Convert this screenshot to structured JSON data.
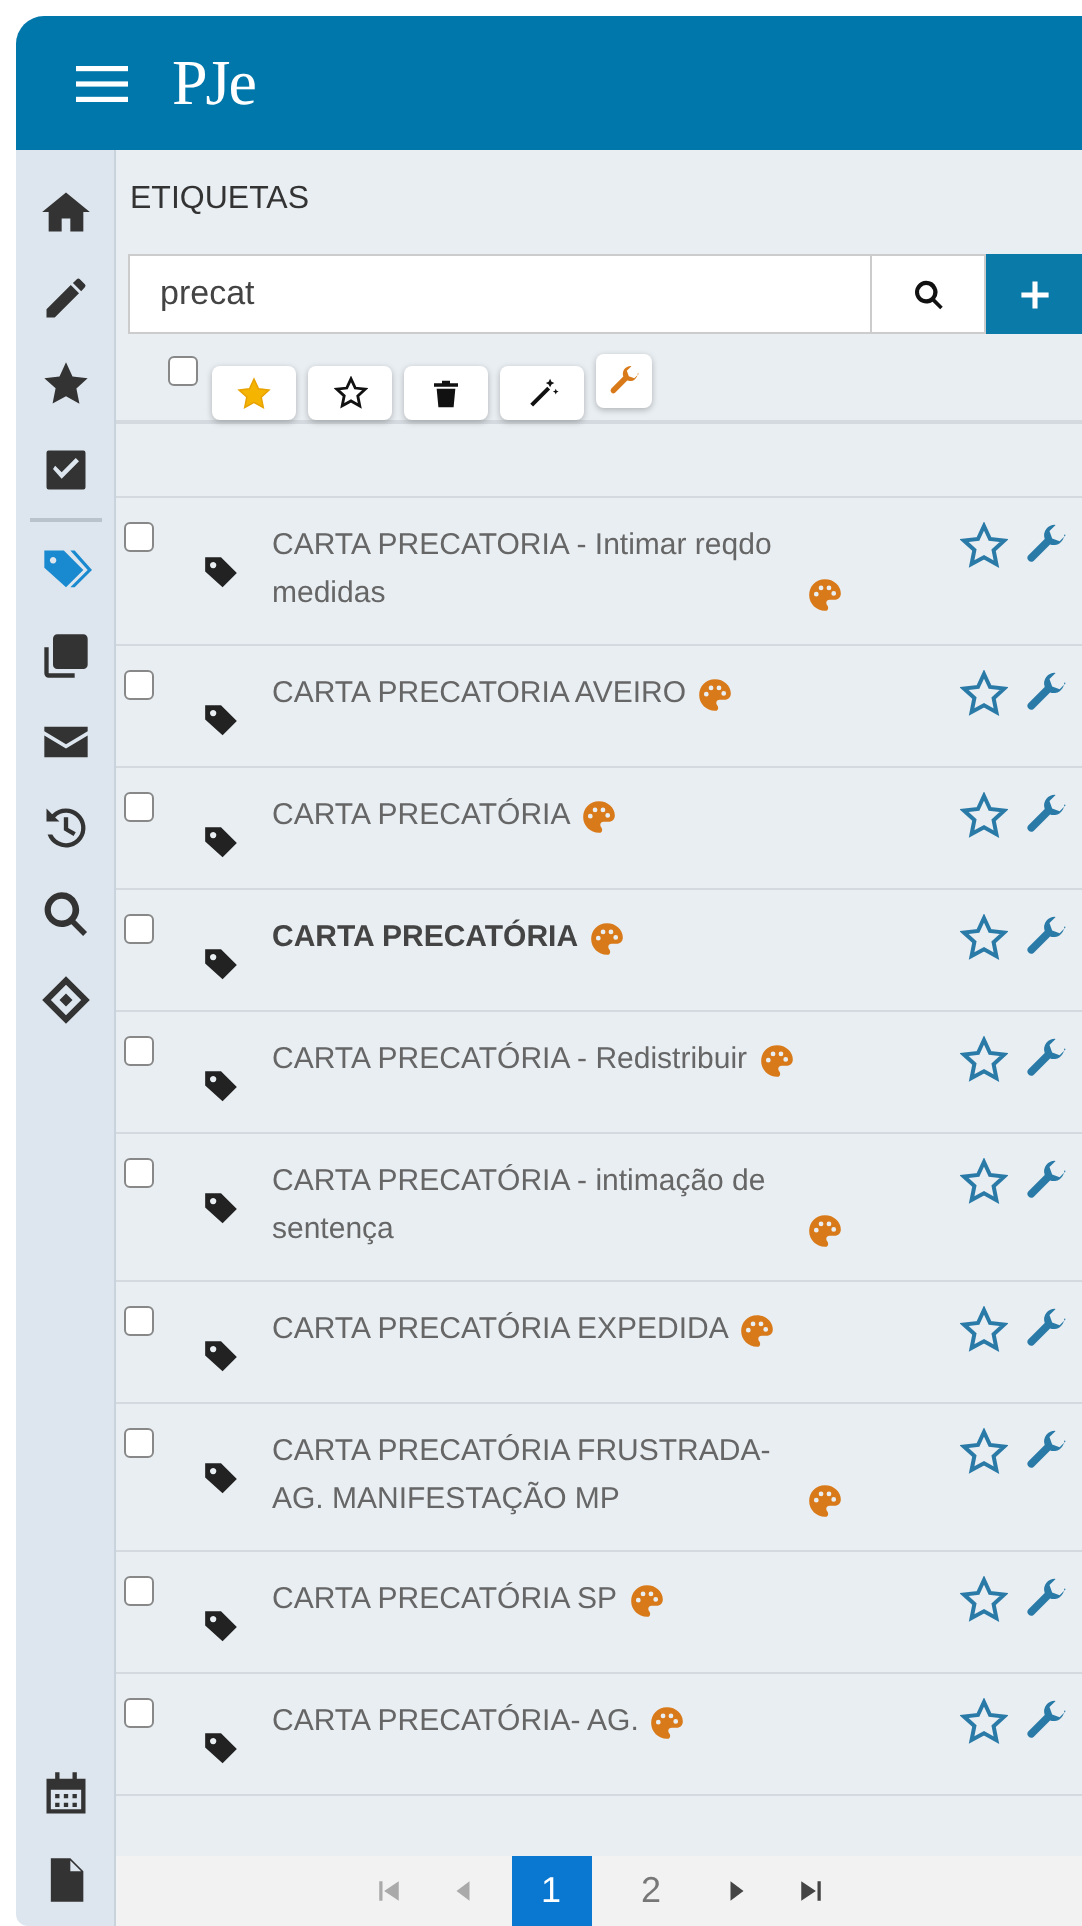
{
  "header": {
    "logo": "PJe"
  },
  "sidebar": {
    "items": [
      {
        "kind": "home",
        "selected": false
      },
      {
        "kind": "pencil",
        "selected": false
      },
      {
        "kind": "star",
        "selected": false
      },
      {
        "kind": "check",
        "selected": false
      },
      {
        "kind": "tags",
        "selected": true
      },
      {
        "kind": "copy",
        "selected": false
      },
      {
        "kind": "mail",
        "selected": false
      },
      {
        "kind": "history",
        "selected": false
      },
      {
        "kind": "search",
        "selected": false
      },
      {
        "kind": "diamond",
        "selected": false
      }
    ],
    "bottom_items": [
      {
        "kind": "calendar",
        "selected": false
      },
      {
        "kind": "document",
        "selected": false
      }
    ]
  },
  "panel": {
    "title": "ETIQUETAS",
    "search": {
      "value": "precat"
    },
    "toolbar": [
      {
        "kind": "star-filled"
      },
      {
        "kind": "star-outline"
      },
      {
        "kind": "trash"
      },
      {
        "kind": "wand"
      },
      {
        "kind": "wrench"
      }
    ],
    "select_all": {
      "checked": false
    },
    "rows": [
      {
        "name": "CARTA PRECATORIA - Intimar reqdo medidas",
        "bold": false,
        "checked": false
      },
      {
        "name": "CARTA PRECATORIA AVEIRO",
        "bold": false,
        "checked": false
      },
      {
        "name": "CARTA PRECATÓRIA",
        "bold": false,
        "checked": false
      },
      {
        "name": "CARTA PRECATÓRIA",
        "bold": true,
        "checked": false
      },
      {
        "name": "CARTA PRECATÓRIA - Redistribuir",
        "bold": false,
        "checked": false
      },
      {
        "name": "CARTA PRECATÓRIA - intimação de sentença",
        "bold": false,
        "checked": false
      },
      {
        "name": "CARTA PRECATÓRIA EXPEDIDA",
        "bold": false,
        "checked": false
      },
      {
        "name": "CARTA PRECATÓRIA FRUSTRADA- AG. MANIFESTAÇÃO MP",
        "bold": false,
        "checked": false
      },
      {
        "name": "CARTA PRECATÓRIA SP",
        "bold": false,
        "checked": false
      },
      {
        "name": "CARTA PRECATÓRIA- AG.",
        "bold": false,
        "checked": false
      }
    ],
    "pagination": {
      "pages": [
        {
          "label": "1",
          "selected": true
        },
        {
          "label": "2",
          "selected": false
        }
      ]
    }
  }
}
